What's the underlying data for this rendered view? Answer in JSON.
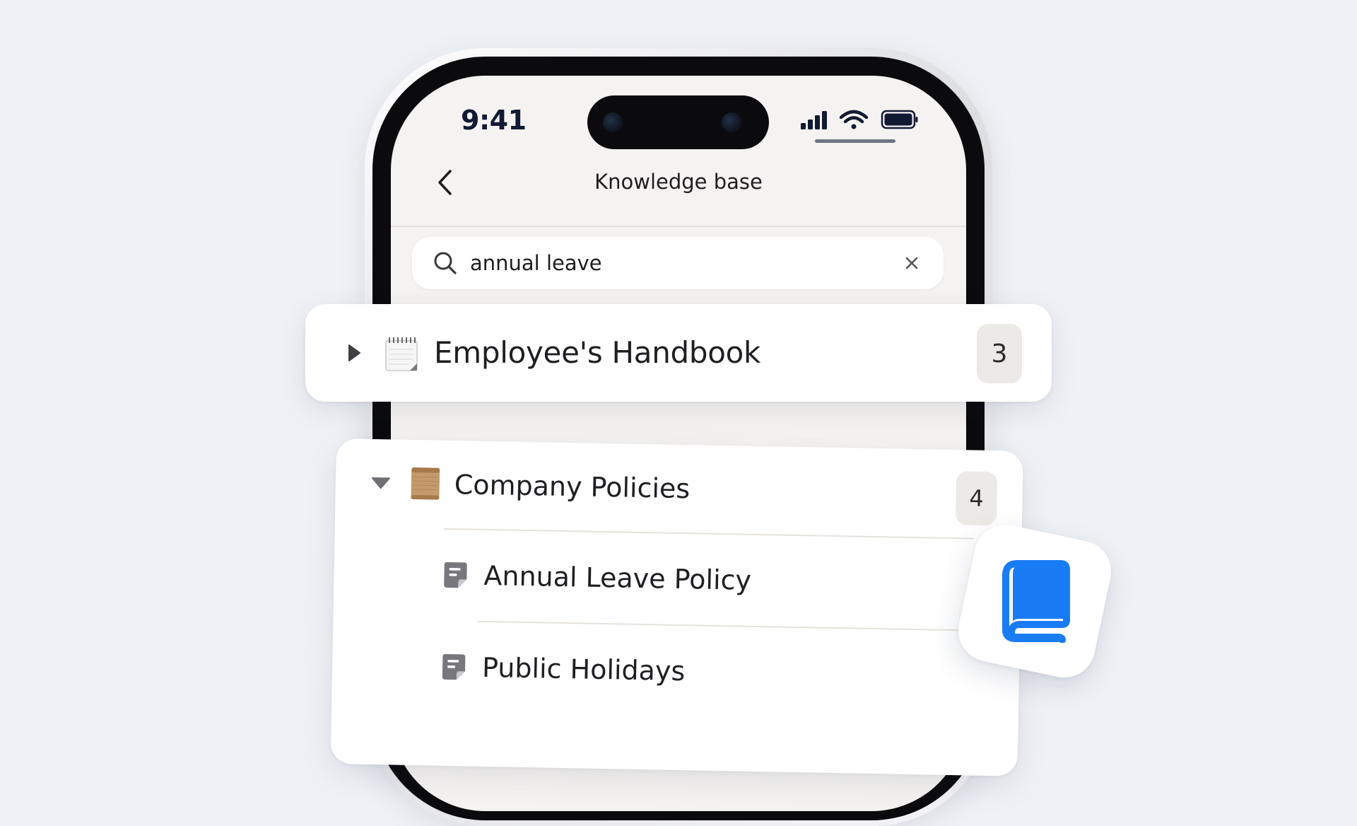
{
  "status_bar": {
    "time": "9:41",
    "icons": [
      "signal-icon",
      "wifi-icon",
      "battery-icon"
    ]
  },
  "nav": {
    "back_icon": "chevron-left-icon",
    "title": "Knowledge base"
  },
  "search": {
    "value": "annual leave",
    "icon": "search-icon",
    "clear_icon": "close-icon"
  },
  "results": [
    {
      "title": "Employee's Handbook",
      "count": "3",
      "expanded": false,
      "icon": "notepad-icon"
    },
    {
      "title": "Company Policies",
      "count": "4",
      "expanded": true,
      "icon": "scroll-icon",
      "items": [
        {
          "label": "Annual Leave Policy",
          "icon": "document-icon"
        },
        {
          "label": "Public Holidays",
          "icon": "document-icon"
        }
      ]
    }
  ],
  "app_icon": {
    "icon": "book-icon",
    "color": "#1a7cf5"
  },
  "colors": {
    "background": "#eff1f6",
    "screen": "#f5f3f1",
    "badge": "#eceae6",
    "accent": "#1a7cf5"
  }
}
